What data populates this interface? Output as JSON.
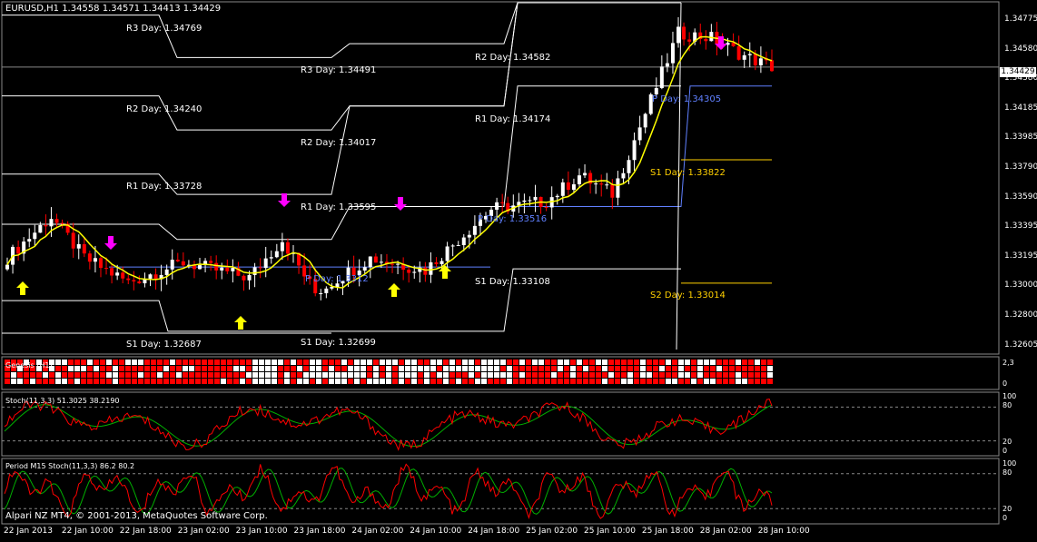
{
  "header": {
    "symbol_info": "EURUSD,H1  1.34558 1.34571 1.34413 1.34429"
  },
  "colors": {
    "background": "#000000",
    "bull_candle": "#ffffff",
    "bear_candle": "#ff0000",
    "ma_line": "#ffff00",
    "r_levels": "#ffffff",
    "p_levels": "#6080ff",
    "s_levels": "#ffd000",
    "arrow_up": "#ffff00",
    "arrow_down": "#ff00ff",
    "stoch_main": "#ff0000",
    "stoch_signal": "#00b000"
  },
  "price_axis": [
    "1.34775",
    "1.34580",
    "1.34380",
    "1.34185",
    "1.33985",
    "1.33790",
    "1.33590",
    "1.33395",
    "1.33195",
    "1.33000",
    "1.32800",
    "1.32605"
  ],
  "current_price": "1.34429",
  "pivot_labels": [
    {
      "text": "R3 Day: 1.34769",
      "kind": "r"
    },
    {
      "text": "R2 Day: 1.34240",
      "kind": "r"
    },
    {
      "text": "R1 Day: 1.33728",
      "kind": "r"
    },
    {
      "text": "S1 Day: 1.32687",
      "kind": "r"
    },
    {
      "text": "R3 Day: 1.34491",
      "kind": "r"
    },
    {
      "text": "R2 Day: 1.34017",
      "kind": "r"
    },
    {
      "text": "R1 Day: 1.33595",
      "kind": "r"
    },
    {
      "text": "S1 Day: 1.32699",
      "kind": "r"
    },
    {
      "text": "P Day: 1.3312",
      "kind": "p"
    },
    {
      "text": "R2 Day: 1.34582",
      "kind": "r"
    },
    {
      "text": "R1 Day: 1.34174",
      "kind": "r"
    },
    {
      "text": "P Day: 1.33516",
      "kind": "p"
    },
    {
      "text": "S1 Day: 1.33108",
      "kind": "r"
    },
    {
      "text": "P Day: 1.34305",
      "kind": "p"
    },
    {
      "text": "S1 Day: 1.33822",
      "kind": "s"
    },
    {
      "text": "S2 Day: 1.33014",
      "kind": "s"
    }
  ],
  "indicators": {
    "genesis": {
      "label": "Genesis (H1)",
      "axis": [
        "2,3",
        "0"
      ]
    },
    "stoch": {
      "label": "Stoch(11,3,3) 51.3025 38.2190",
      "axis": [
        "100",
        "80",
        "20",
        "0"
      ]
    },
    "period": {
      "label": "Period M15 Stoch(11,3,3) 86.2 80.2",
      "axis": [
        "100",
        "80",
        "20",
        "0"
      ]
    }
  },
  "footer": {
    "copyright": "Alpari NZ MT4, © 2001-2013, MetaQuotes Software Corp."
  },
  "time_axis": [
    "22 Jan 2013",
    "22 Jan 10:00",
    "22 Jan 18:00",
    "23 Jan 02:00",
    "23 Jan 10:00",
    "23 Jan 18:00",
    "24 Jan 02:00",
    "24 Jan 10:00",
    "24 Jan 18:00",
    "25 Jan 02:00",
    "25 Jan 10:00",
    "25 Jan 18:00",
    "28 Jan 02:00",
    "28 Jan 10:00"
  ],
  "chart_data": {
    "type": "candlestick",
    "symbol": "EURUSD",
    "timeframe": "H1",
    "ylim": [
      1.3255,
      1.3485
    ],
    "last": 1.34429,
    "pivot_levels": {
      "day1": {
        "R3": 1.34769,
        "R2": 1.3424,
        "R1": 1.33728,
        "S1": 1.32687
      },
      "day2": {
        "R3": 1.34491,
        "R2": 1.34017,
        "R1": 1.33595,
        "P": 1.3312,
        "S1": 1.32699
      },
      "day3": {
        "R2": 1.34582,
        "R1": 1.34174,
        "P": 1.33516,
        "S1": 1.33108
      },
      "day4": {
        "P": 1.34305,
        "S1": 1.33822,
        "S2": 1.33014
      }
    }
  }
}
